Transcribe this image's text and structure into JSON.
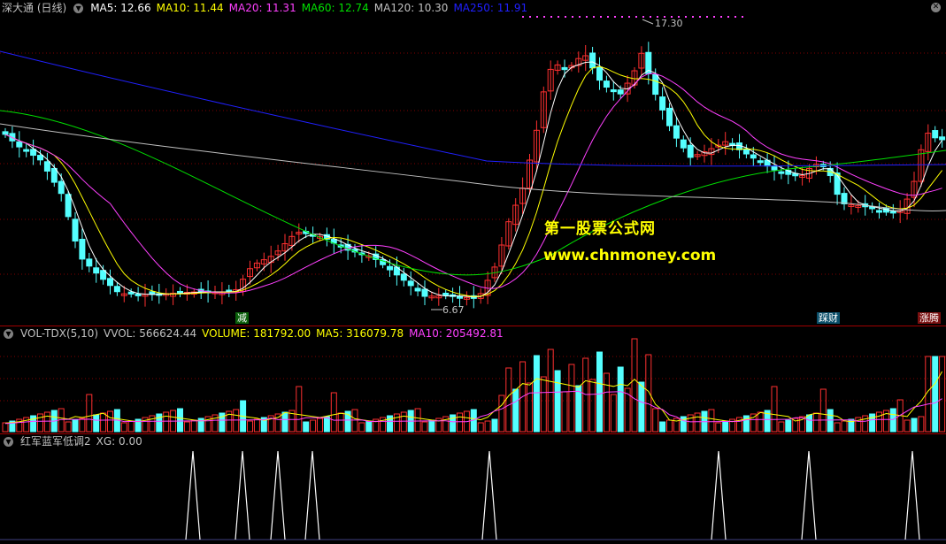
{
  "main": {
    "title": "深大通 (日线)",
    "indicators": [
      {
        "label": "MA5: 12.66",
        "color": "#ffffff"
      },
      {
        "label": "MA10: 11.44",
        "color": "#ffff00"
      },
      {
        "label": "MA20: 11.31",
        "color": "#ff40ff"
      },
      {
        "label": "MA60: 12.74",
        "color": "#00e000"
      },
      {
        "label": "MA120: 10.30",
        "color": "#c0c0c0"
      },
      {
        "label": "MA250: 11.91",
        "color": "#2020ff"
      }
    ],
    "high_label": "17.30",
    "low_label": "6.67",
    "watermark_cn": "第一股票公式网",
    "watermark_url": "www.chnmoney.com",
    "signals": [
      "减",
      "踩财",
      "涨腾"
    ],
    "colors": {
      "up": "#ff3030",
      "down": "#54ffff",
      "grid": "#800000"
    }
  },
  "vol": {
    "title": "VOL-TDX(5,10)",
    "indicators": [
      {
        "label": "VVOL: 566624.44",
        "color": "#c0c0c0"
      },
      {
        "label": "VOLUME: 181792.00",
        "color": "#ffff00"
      },
      {
        "label": "MA5: 316079.78",
        "color": "#ffff00"
      },
      {
        "label": "MA10: 205492.81",
        "color": "#ff40ff"
      }
    ]
  },
  "xg": {
    "title": "红军蓝军低调2",
    "indicators": [
      {
        "label": "XG: 0.00",
        "color": "#c0c0c0"
      }
    ]
  }
}
